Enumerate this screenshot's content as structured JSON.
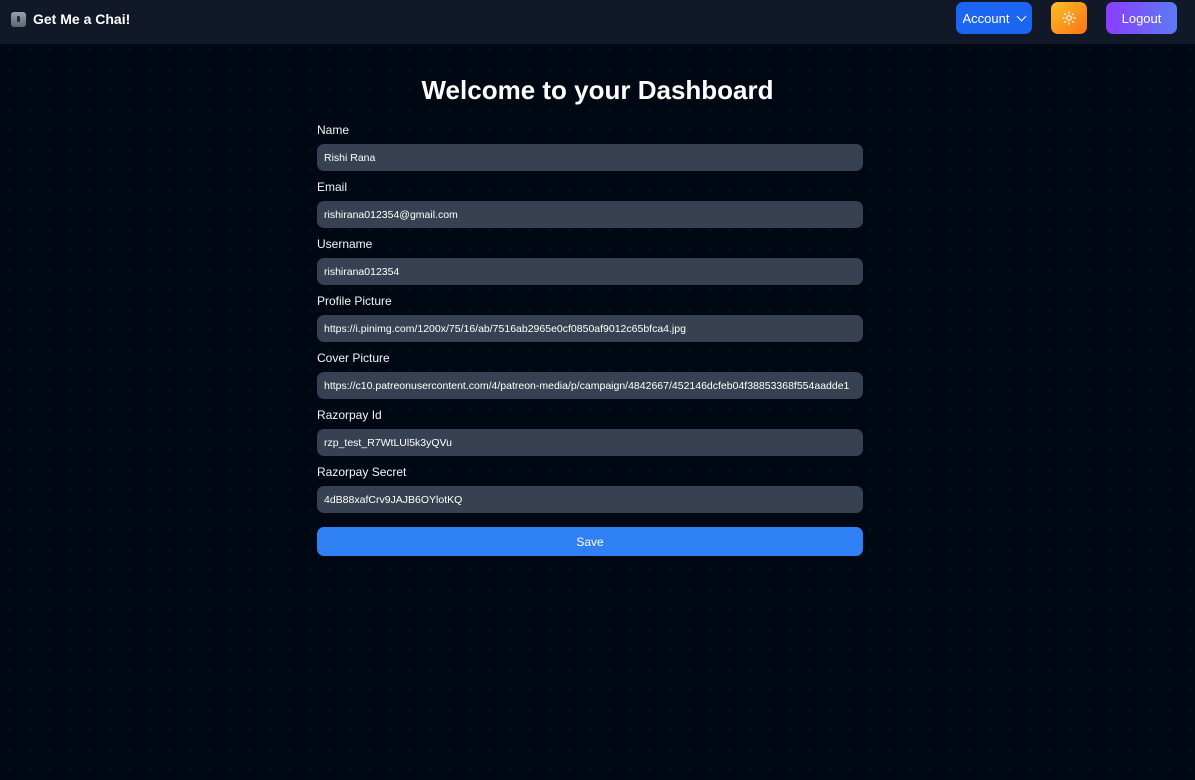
{
  "brand": {
    "name": "Get Me a Chai!",
    "icon": "kettle-icon"
  },
  "nav": {
    "account_label": "Account",
    "account_icon": "chevron-down-icon",
    "theme_icon": "sun-icon",
    "logout_label": "Logout"
  },
  "page": {
    "title": "Welcome to your Dashboard"
  },
  "form": {
    "fields": [
      {
        "label": "Name",
        "value": "Rishi Rana"
      },
      {
        "label": "Email",
        "value": "rishirana012354@gmail.com"
      },
      {
        "label": "Username",
        "value": "rishirana012354"
      },
      {
        "label": "Profile Picture",
        "value": "https://i.pinimg.com/1200x/75/16/ab/7516ab2965e0cf0850af9012c65bfca4.jpg"
      },
      {
        "label": "Cover Picture",
        "value": "https://c10.patreonusercontent.com/4/patreon-media/p/campaign/4842667/452146dcfeb04f38853368f554aadde1"
      },
      {
        "label": "Razorpay Id",
        "value": "rzp_test_R7WtLUl5k3yQVu"
      },
      {
        "label": "Razorpay Secret",
        "value": "4dB88xafCrv9JAJB6OYlotKQ"
      }
    ],
    "save_label": "Save"
  },
  "colors": {
    "background": "#000814",
    "navbar": "#111827",
    "input_bg": "#374151",
    "account_button": "#1c64f2",
    "save_button": "#2f80f5",
    "logout_gradient_start": "#8b3dff",
    "logout_gradient_end": "#5b7bf2",
    "theme_gradient_start": "#fbbf24",
    "theme_gradient_end": "#f97316"
  }
}
